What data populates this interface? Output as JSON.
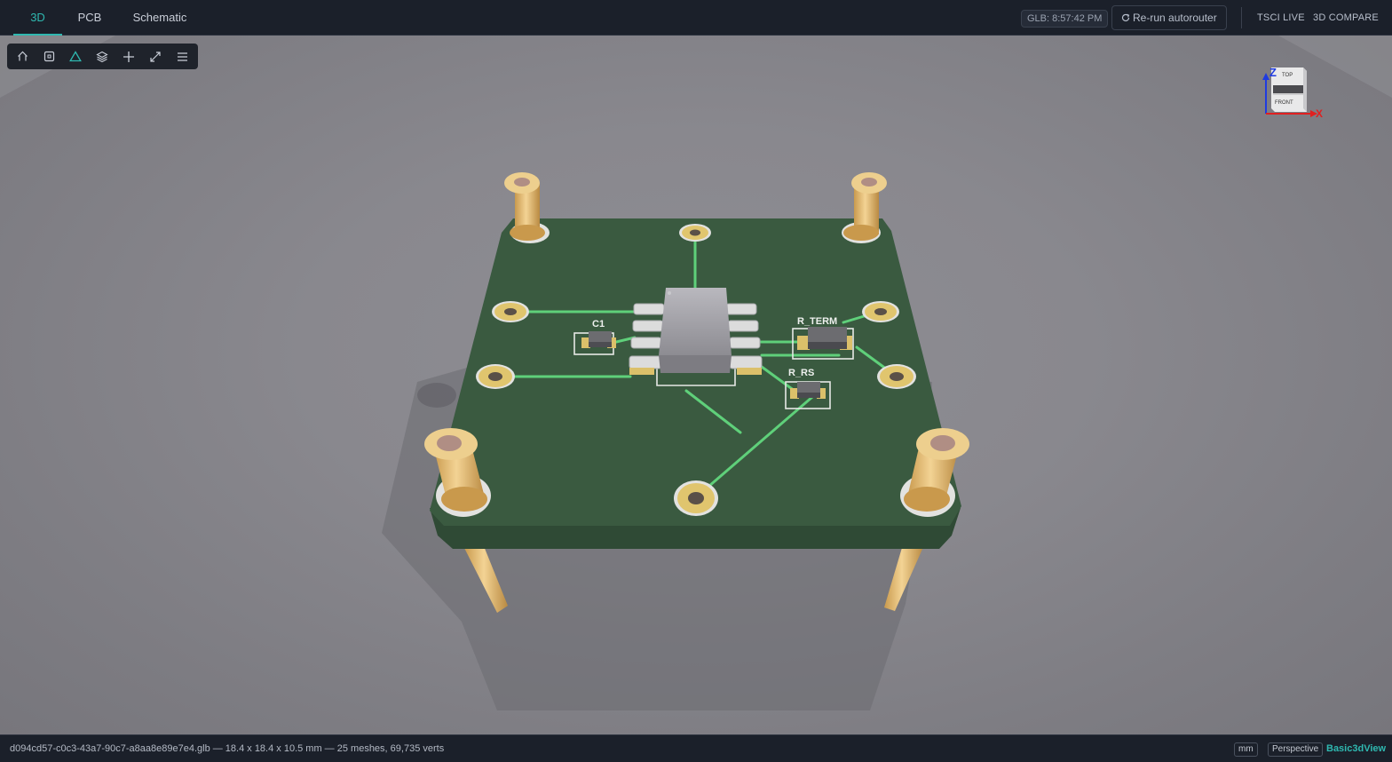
{
  "tabs": [
    {
      "label": "3D",
      "active": true
    },
    {
      "label": "PCB",
      "active": false
    },
    {
      "label": "Schematic",
      "active": false
    }
  ],
  "header": {
    "glb_timestamp": "GLB: 8:57:42 PM",
    "rerun_label": "Re-run autorouter",
    "tsci_live_label": "TSCI LIVE",
    "compare_label": "3D COMPARE"
  },
  "toolbar": {
    "items": [
      "home-icon",
      "frame-icon",
      "triangle-icon",
      "layers-icon",
      "move-icon",
      "expand-icon",
      "menu-icon"
    ],
    "active": "triangle-icon",
    "accent": "#2fb8b0"
  },
  "gizmo": {
    "top_label": "TOP",
    "front_label": "FRONT",
    "z_label": "Z",
    "x_label": "X",
    "z_color": "#1f3be0",
    "x_color": "#e02020"
  },
  "board": {
    "color": "#3a5a40",
    "trace_color": "#5fd07a",
    "labels": {
      "c1": "C1",
      "r_term": "R_TERM",
      "r_rs": "R_RS"
    }
  },
  "status": {
    "file_info": "d094cd57-c0c3-43a7-90c7-a8aa8e89e7e4.glb — 18.4 x 18.4 x 10.5 mm — 25 meshes, 69,735 verts",
    "unit": "mm",
    "projection": "Perspective",
    "viewer_name": "Basic3dView"
  }
}
